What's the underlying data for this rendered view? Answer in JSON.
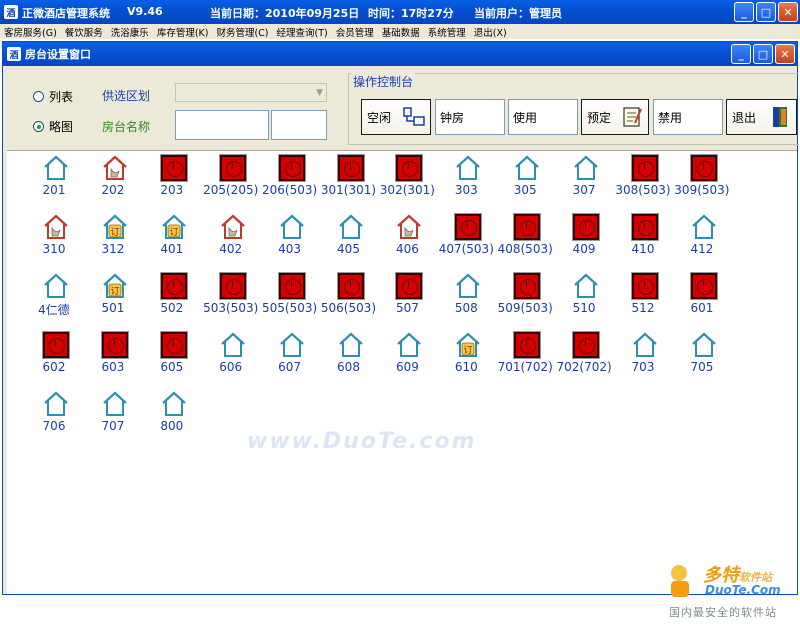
{
  "app": {
    "title": "正微酒店管理系统",
    "version": "V9.46",
    "date_label": "当前日期：2010年09月25日",
    "time_label": "时间：17时27分",
    "user_label": "当前用户：管理员"
  },
  "menu": [
    "客房服务(G)",
    "餐饮服务",
    "洗浴康乐",
    "库存管理(K)",
    "财务管理(C)",
    "经理查询(T)",
    "会员管理",
    "基础数据",
    "系统管理",
    "退出(X)"
  ],
  "window": {
    "title": "房台设置窗口"
  },
  "filter": {
    "view_list": "列表",
    "view_thumb": "略图",
    "region_label": "供选区划",
    "name_label": "房台名称",
    "selected_view": "略图"
  },
  "console": {
    "title": "操作控制台",
    "buttons": {
      "free": "空闲",
      "hourly": "钟房",
      "in_use": "使用",
      "reserve": "预定",
      "disabled": "禁用",
      "exit": "退出"
    }
  },
  "rooms": [
    {
      "name": "201",
      "status": "empty"
    },
    {
      "name": "202",
      "status": "dirty"
    },
    {
      "name": "203",
      "status": "busy"
    },
    {
      "name": "205(205)",
      "status": "busy"
    },
    {
      "name": "206(503)",
      "status": "busy"
    },
    {
      "name": "301(301)",
      "status": "busy"
    },
    {
      "name": "302(301)",
      "status": "busy"
    },
    {
      "name": "303",
      "status": "empty"
    },
    {
      "name": "305",
      "status": "empty"
    },
    {
      "name": "307",
      "status": "empty"
    },
    {
      "name": "308(503)",
      "status": "busy"
    },
    {
      "name": "309(503)",
      "status": "busy"
    },
    {
      "name": "310",
      "status": "dirty"
    },
    {
      "name": "312",
      "status": "reserved"
    },
    {
      "name": "401",
      "status": "reserved"
    },
    {
      "name": "402",
      "status": "dirty"
    },
    {
      "name": "403",
      "status": "empty"
    },
    {
      "name": "405",
      "status": "empty"
    },
    {
      "name": "406",
      "status": "dirty"
    },
    {
      "name": "407(503)",
      "status": "busy"
    },
    {
      "name": "408(503)",
      "status": "busy"
    },
    {
      "name": "409",
      "status": "busy"
    },
    {
      "name": "410",
      "status": "busy"
    },
    {
      "name": "412",
      "status": "empty"
    },
    {
      "name": "4仁德",
      "status": "empty"
    },
    {
      "name": "501",
      "status": "reserved"
    },
    {
      "name": "502",
      "status": "busy"
    },
    {
      "name": "503(503)",
      "status": "busy"
    },
    {
      "name": "505(503)",
      "status": "busy"
    },
    {
      "name": "506(503)",
      "status": "busy"
    },
    {
      "name": "507",
      "status": "busy"
    },
    {
      "name": "508",
      "status": "empty"
    },
    {
      "name": "509(503)",
      "status": "busy"
    },
    {
      "name": "510",
      "status": "empty"
    },
    {
      "name": "512",
      "status": "busy"
    },
    {
      "name": "601",
      "status": "busy"
    },
    {
      "name": "602",
      "status": "busy"
    },
    {
      "name": "603",
      "status": "busy"
    },
    {
      "name": "605",
      "status": "busy"
    },
    {
      "name": "606",
      "status": "empty"
    },
    {
      "name": "607",
      "status": "empty"
    },
    {
      "name": "608",
      "status": "empty"
    },
    {
      "name": "609",
      "status": "empty"
    },
    {
      "name": "610",
      "status": "reserved"
    },
    {
      "name": "701(702)",
      "status": "busy"
    },
    {
      "name": "702(702)",
      "status": "busy"
    },
    {
      "name": "703",
      "status": "empty"
    },
    {
      "name": "705",
      "status": "empty"
    },
    {
      "name": "706",
      "status": "empty"
    },
    {
      "name": "707",
      "status": "empty"
    },
    {
      "name": "800",
      "status": "empty"
    }
  ],
  "watermark": "www.DuoTe.com",
  "brand": {
    "name": "多特",
    "sub": "软件站",
    "site": "DuoTe.Com",
    "slogan": "国内最安全的软件站"
  },
  "colors": {
    "titlebar": "#0551d1",
    "busy": "#d40000",
    "house": "#2f8fb0",
    "text_blue": "#1a3ea8"
  }
}
